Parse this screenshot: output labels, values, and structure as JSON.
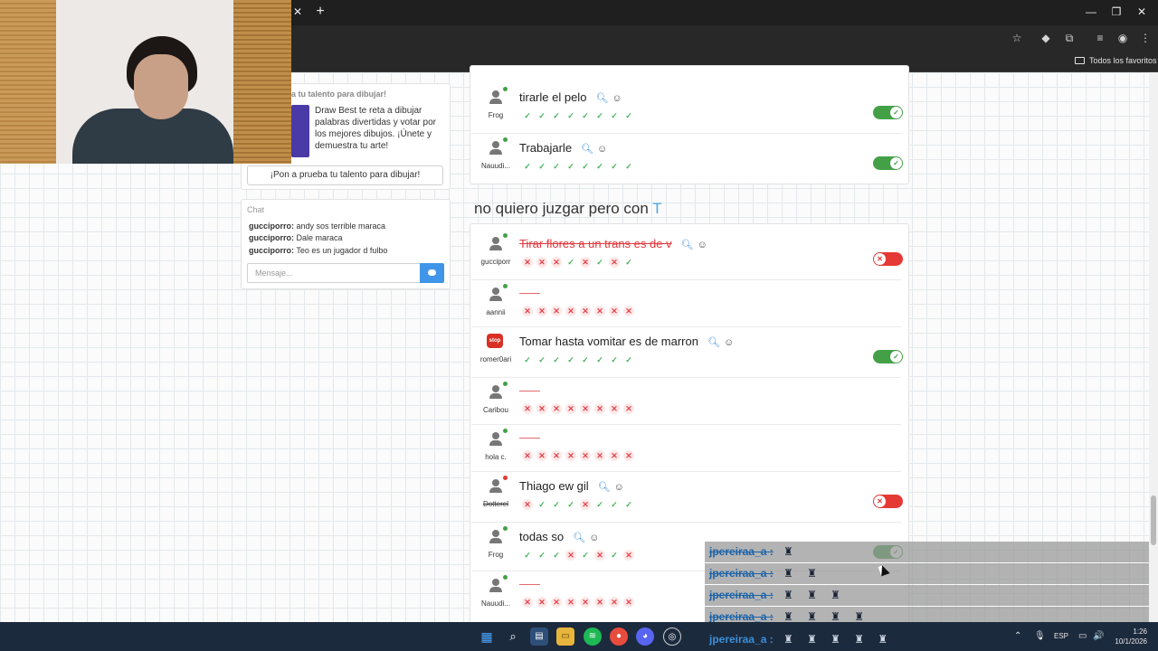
{
  "browser": {
    "bookmarks_folder": "Todos los favoritos"
  },
  "promo": {
    "title": "a tu talento para dibujar!",
    "text": "Draw Best te reta a dibujar palabras divertidas y votar por los mejores dibujos. ¡Únete y demuestra tu arte!",
    "button": "¡Pon a prueba tu talento para dibujar!"
  },
  "chat": {
    "title": "Chat",
    "messages": [
      {
        "user": "gucciporro:",
        "text": " andy sos terrible maraca"
      },
      {
        "user": "gucciporro:",
        "text": " Dale maraca"
      },
      {
        "user": "gucciporro:",
        "text": " Teo es un jugador d fulbo"
      }
    ],
    "placeholder": "Mensaje..."
  },
  "round_prev": {
    "rows": [
      {
        "user": "Frog",
        "answer": "tirarle el pelo",
        "votes": [
          "yes",
          "yes",
          "yes",
          "yes",
          "yes",
          "yes",
          "yes",
          "yes"
        ],
        "accepted": true
      },
      {
        "user": "Nauudi...",
        "answer": "Trabajarle",
        "votes": [
          "yes",
          "yes",
          "yes",
          "yes",
          "yes",
          "yes",
          "yes",
          "yes"
        ],
        "accepted": true
      }
    ]
  },
  "round": {
    "title": "no quiero juzgar pero con",
    "letter": "T",
    "rows": [
      {
        "user": "gucciporr",
        "answer": "Tirar flores a un trans es de v",
        "status": "rejected",
        "votes": [
          "no",
          "no",
          "no",
          "yes",
          "no",
          "yes",
          "no",
          "yes"
        ],
        "accepted": false
      },
      {
        "user": "aannii",
        "answer": "",
        "votes": [
          "no",
          "no",
          "no",
          "no",
          "no",
          "no",
          "no",
          "no"
        ]
      },
      {
        "user": "romer0ari",
        "answer": "Tomar hasta vomitar es de marron",
        "votes": [
          "yes",
          "yes",
          "yes",
          "yes",
          "yes",
          "yes",
          "yes",
          "yes"
        ],
        "accepted": true,
        "avatar": "stop"
      },
      {
        "user": "Caribou",
        "answer": "",
        "votes": [
          "no",
          "no",
          "no",
          "no",
          "no",
          "no",
          "no",
          "no"
        ]
      },
      {
        "user": "hola c.",
        "answer": "",
        "votes": [
          "no",
          "no",
          "no",
          "no",
          "no",
          "no",
          "no",
          "no"
        ]
      },
      {
        "user": "Dotterel",
        "answer": "Thiago ew gil",
        "votes": [
          "no",
          "yes",
          "yes",
          "yes",
          "no",
          "yes",
          "yes",
          "yes"
        ],
        "accepted": false
      },
      {
        "user": "Frog",
        "answer": "todas so",
        "votes": [
          "yes",
          "yes",
          "yes",
          "no",
          "yes",
          "no",
          "yes",
          "no"
        ],
        "accepted": true
      },
      {
        "user": "Nauudi...",
        "answer": "",
        "votes": [
          "no",
          "no",
          "no",
          "no",
          "no",
          "no",
          "no",
          "no"
        ]
      }
    ]
  },
  "stream_overlay": {
    "lines": [
      {
        "name": "jpereiraa_a",
        "sep": ":",
        "emotes": "♜"
      },
      {
        "name": "jpereiraa_a",
        "sep": ":",
        "emotes": "♜ ♜"
      },
      {
        "name": "jpereiraa_a",
        "sep": ":",
        "emotes": "♜ ♜ ♜"
      },
      {
        "name": "jpereiraa_a",
        "sep": ":",
        "emotes": "♜ ♜ ♜ ♜"
      }
    ],
    "taskbar_line": {
      "name": "jpereiraa_a",
      "sep": ":",
      "emotes": "♜ ♜ ♜ ♜ ♜"
    }
  },
  "taskbar": {
    "lang": "ESP",
    "time": "1:26",
    "date": "10/1/2026"
  },
  "colors": {
    "accepted": "#43a047",
    "rejected": "#e53935",
    "accent": "#3f96e8"
  }
}
